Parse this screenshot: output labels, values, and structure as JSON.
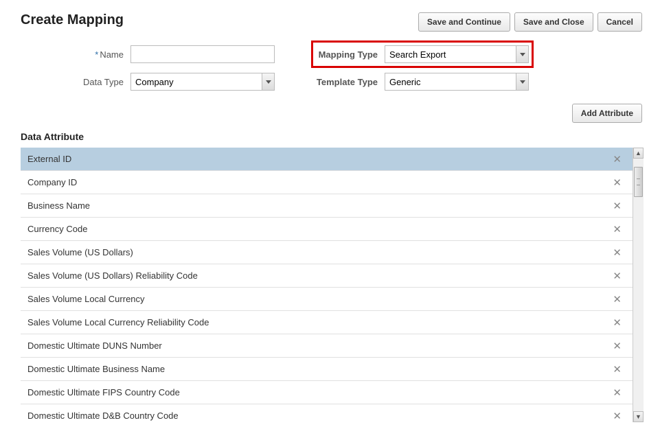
{
  "page_title": "Create Mapping",
  "header_buttons": {
    "save_continue": "Save and Continue",
    "save_close": "Save and Close",
    "cancel": "Cancel"
  },
  "form": {
    "name_label": "Name",
    "name_value": "",
    "data_type_label": "Data Type",
    "data_type_value": "Company",
    "mapping_type_label": "Mapping Type",
    "mapping_type_value": "Search Export",
    "template_type_label": "Template Type",
    "template_type_value": "Generic"
  },
  "add_attribute_label": "Add Attribute",
  "section_title": "Data Attribute",
  "attributes": [
    {
      "label": "External ID",
      "selected": true
    },
    {
      "label": "Company ID",
      "selected": false
    },
    {
      "label": "Business Name",
      "selected": false
    },
    {
      "label": "Currency Code",
      "selected": false
    },
    {
      "label": "Sales Volume (US Dollars)",
      "selected": false
    },
    {
      "label": "Sales Volume (US Dollars) Reliability Code",
      "selected": false
    },
    {
      "label": "Sales Volume Local Currency",
      "selected": false
    },
    {
      "label": "Sales Volume Local Currency Reliability Code",
      "selected": false
    },
    {
      "label": "Domestic Ultimate DUNS Number",
      "selected": false
    },
    {
      "label": "Domestic Ultimate Business Name",
      "selected": false
    },
    {
      "label": "Domestic Ultimate FIPS Country Code",
      "selected": false
    },
    {
      "label": "Domestic Ultimate D&B Country Code",
      "selected": false
    }
  ]
}
